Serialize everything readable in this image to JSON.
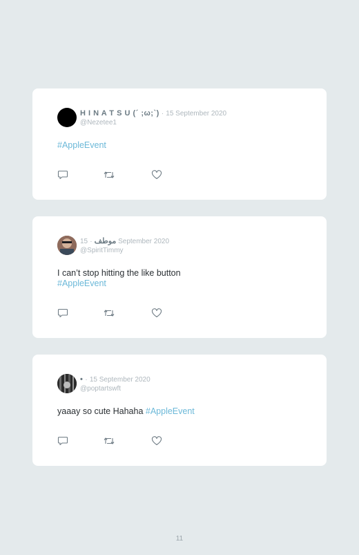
{
  "tweets": [
    {
      "name": "H I N A T S U (´ ;ω;`)",
      "date_sep": "·",
      "date": "15 September 2020",
      "handle": "@Nezetee1",
      "text": "",
      "hashtag": "#AppleEvent",
      "avatar": "solid-black"
    },
    {
      "name": "موطف",
      "date_sep": "·",
      "date": "15 September 2020",
      "handle": "@SpiritTimmy",
      "text": "I can’t stop hitting the like button",
      "hashtag": "#AppleEvent",
      "avatar": "photo"
    },
    {
      "name": "•",
      "date_sep": "·",
      "date": "15 September 2020",
      "handle": "@poptartswft",
      "text": "yaaay so cute Hahaha",
      "hashtag": "#AppleEvent",
      "avatar": "photo-dark"
    }
  ],
  "icons": {
    "reply": "reply-icon",
    "retweet": "retweet-icon",
    "like": "like-icon"
  },
  "colors": {
    "background": "#e4eaec",
    "card": "#ffffff",
    "hashtag": "#6bb8d8",
    "muted": "#aeb7bd"
  },
  "page": {
    "number": "11"
  }
}
